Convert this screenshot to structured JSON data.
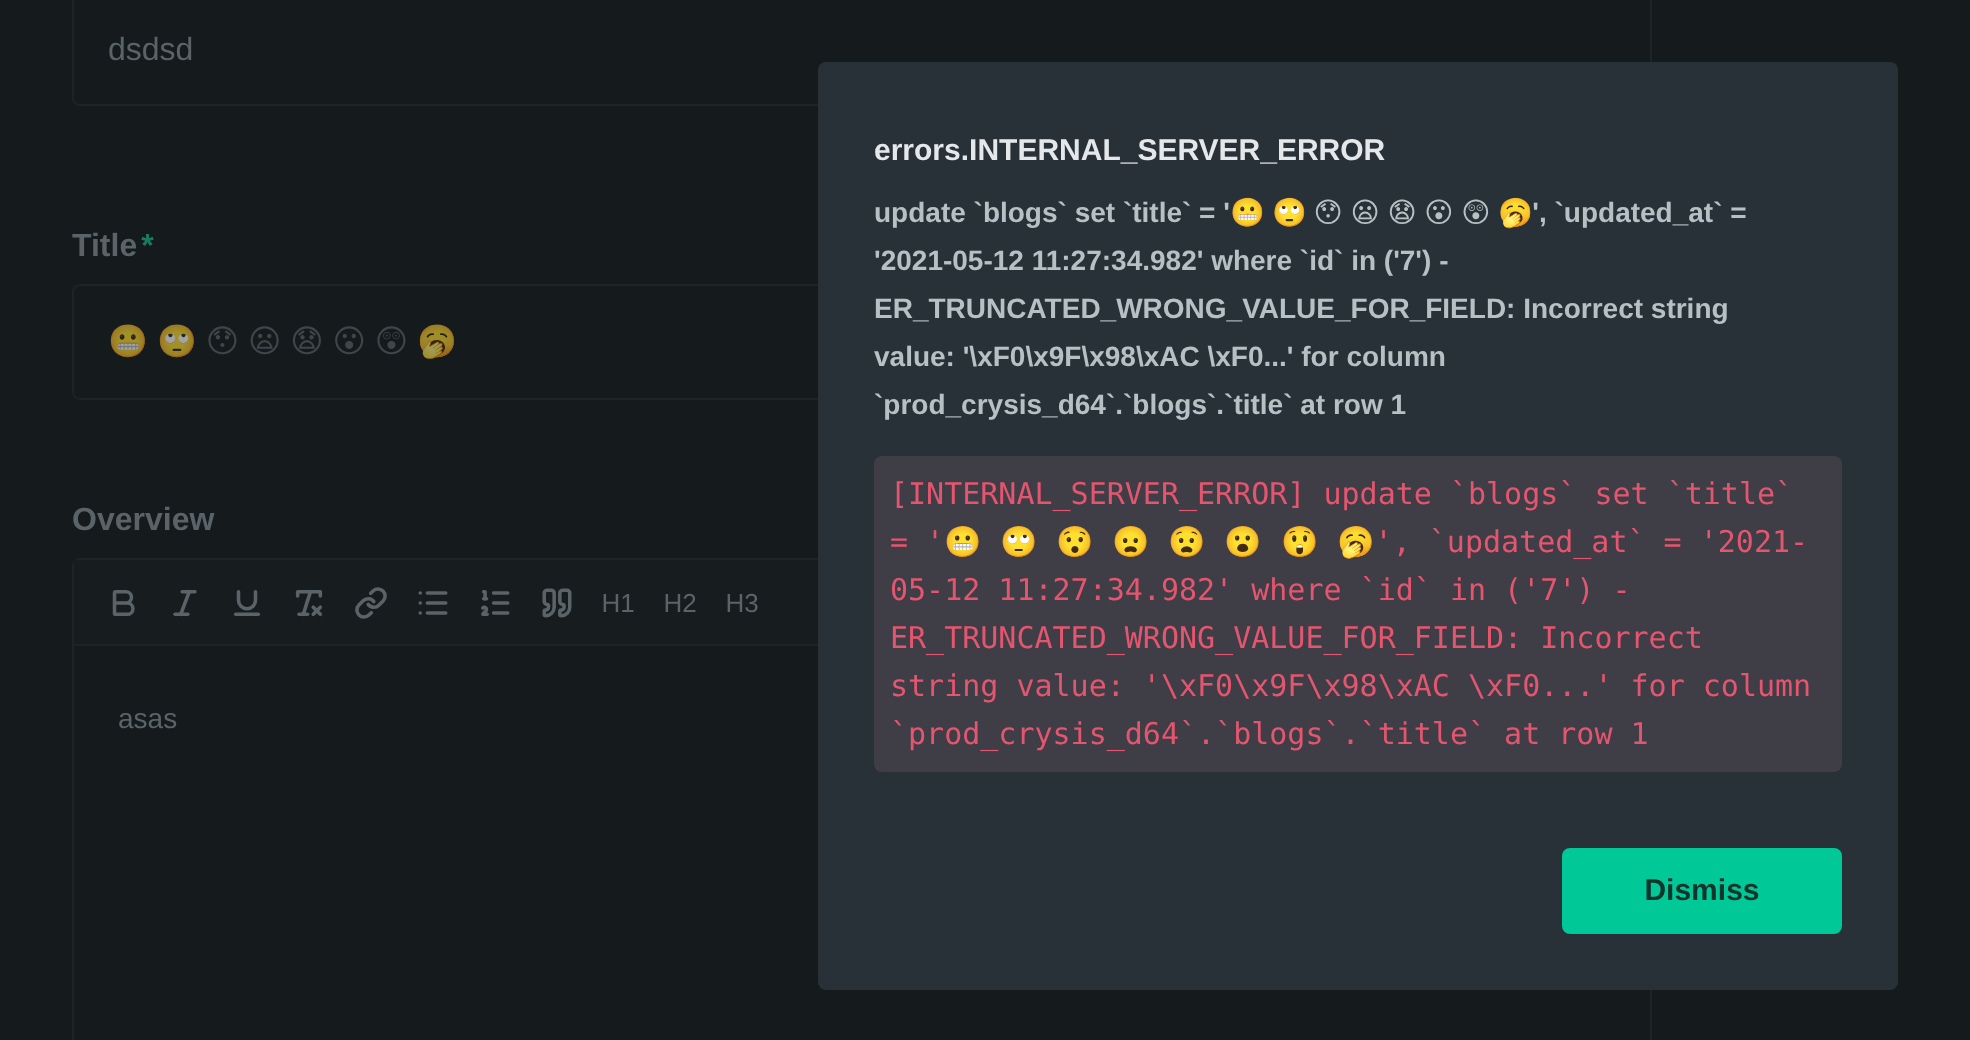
{
  "form": {
    "field_top": {
      "value": "dsdsd"
    },
    "title_field": {
      "label": "Title",
      "required_mark": "*",
      "value": "😬 🙄 😯 😦 😧 😮 😲 🥱"
    },
    "overview": {
      "label": "Overview",
      "toolbar": [
        {
          "kind": "bold"
        },
        {
          "kind": "italic"
        },
        {
          "kind": "underline"
        },
        {
          "kind": "clear"
        },
        {
          "kind": "link"
        },
        {
          "kind": "bullets"
        },
        {
          "kind": "numbers"
        },
        {
          "kind": "quote"
        },
        {
          "kind": "text",
          "label": "H1"
        },
        {
          "kind": "text",
          "label": "H2"
        },
        {
          "kind": "text",
          "label": "H3"
        }
      ],
      "value": "asas"
    }
  },
  "dialog": {
    "title": "errors.INTERNAL_SERVER_ERROR",
    "message": "update `blogs` set `title` = '😬 🙄 😯 😦 😧 😮 😲 🥱', `updated_at` = '2021-05-12 11:27:34.982' where `id` in ('7') - ER_TRUNCATED_WRONG_VALUE_FOR_FIELD: Incorrect string value: '\\xF0\\x9F\\x98\\xAC \\xF0...' for column `prod_crysis_d64`.`blogs`.`title` at row 1",
    "details": "[INTERNAL_SERVER_ERROR] update `blogs` set `title` = '😬 🙄 😯 😦 😧 😮 😲 🥱', `updated_at` = '2021-05-12 11:27:34.982' where `id` in ('7') - ER_TRUNCATED_WRONG_VALUE_FOR_FIELD: Incorrect string value: '\\xF0\\x9F\\x98\\xAC \\xF0...' for column `prod_crysis_d64`.`blogs`.`title` at row 1",
    "button": "Dismiss"
  }
}
